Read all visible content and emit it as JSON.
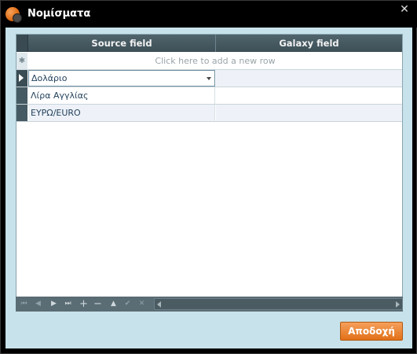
{
  "window": {
    "title": "Νομίσματα",
    "close_glyph": "✕"
  },
  "grid": {
    "columns": [
      "Source field",
      "Galaxy field"
    ],
    "new_row_text": "Click here to add a new row",
    "new_row_glyph": "✱",
    "rows": [
      {
        "source": "Δολάριο",
        "galaxy": ""
      },
      {
        "source": "Λίρα Αγγλίας",
        "galaxy": ""
      },
      {
        "source": "ΕΥΡΩ/EURO",
        "galaxy": ""
      }
    ]
  },
  "navigator": {
    "first": "⏮",
    "prev": "◀",
    "next": "▶",
    "last": "⏭",
    "add": "+",
    "remove": "−",
    "up": "▲",
    "save": "✔",
    "cancel": "✕"
  },
  "buttons": {
    "accept": "Αποδοχή"
  }
}
